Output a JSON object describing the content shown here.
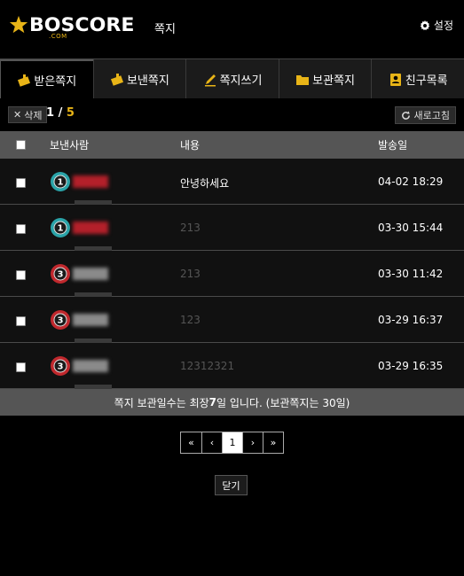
{
  "header": {
    "logo_text": "BOSCORE",
    "logo_sub": ".COM",
    "title": "쪽지",
    "settings_label": "설정"
  },
  "tabs": [
    {
      "label": "받은쪽지",
      "icon": "received-icon",
      "active": true
    },
    {
      "label": "보낸쪽지",
      "icon": "sent-icon",
      "active": false
    },
    {
      "label": "쪽지쓰기",
      "icon": "pencil-icon",
      "active": false
    },
    {
      "label": "보관쪽지",
      "icon": "folder-icon",
      "active": false
    },
    {
      "label": "친구목록",
      "icon": "contacts-icon",
      "active": false
    }
  ],
  "toolbar": {
    "delete_label": "삭제",
    "page_current": "1",
    "page_separator": " / ",
    "page_total": "5",
    "refresh_label": "새로고침"
  },
  "table": {
    "headers": {
      "sender": "보낸사람",
      "content": "내용",
      "date": "발송일"
    },
    "rows": [
      {
        "level": "1",
        "level_color": "#2aa3a8",
        "nick_color": "#b3202a",
        "content": "안녕하세요",
        "content_color": "#ffffff",
        "date": "04-02 18:29"
      },
      {
        "level": "1",
        "level_color": "#2aa3a8",
        "nick_color": "#b3202a",
        "content": "213",
        "content_color": "#555555",
        "date": "03-30 15:44"
      },
      {
        "level": "3",
        "level_color": "#c0282d",
        "nick_color": "#8a8a8a",
        "content": "213",
        "content_color": "#555555",
        "date": "03-30 11:42"
      },
      {
        "level": "3",
        "level_color": "#c0282d",
        "nick_color": "#8a8a8a",
        "content": "123",
        "content_color": "#555555",
        "date": "03-29 16:37"
      },
      {
        "level": "3",
        "level_color": "#c0282d",
        "nick_color": "#8a8a8a",
        "content": "12312321",
        "content_color": "#555555",
        "date": "03-29 16:35"
      }
    ]
  },
  "notice": {
    "before": "쪽지 보관일수는 최장 ",
    "days": "7",
    "after": "일 입니다. (보관쪽지는 30일)"
  },
  "pagination": {
    "first": "«",
    "prev": "‹",
    "current": "1",
    "next": "›",
    "last": "»"
  },
  "close_label": "닫기",
  "colors": {
    "accent": "#e8b417",
    "header_bar": "#555555",
    "row_bg": "#111111"
  }
}
